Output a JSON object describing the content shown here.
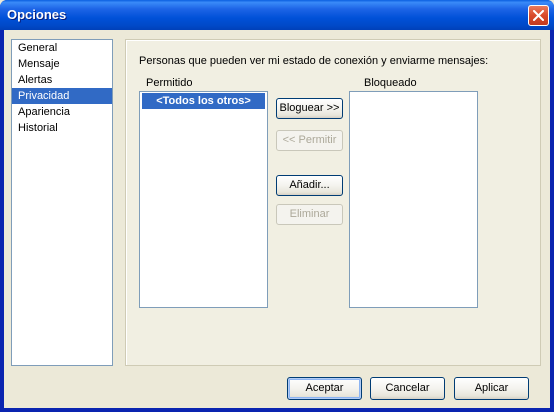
{
  "window": {
    "title": "Opciones",
    "close_icon": "close-icon"
  },
  "sidebar": {
    "items": [
      {
        "label": "General",
        "selected": false
      },
      {
        "label": "Mensaje",
        "selected": false
      },
      {
        "label": "Alertas",
        "selected": false
      },
      {
        "label": "Privacidad",
        "selected": true
      },
      {
        "label": "Apariencia",
        "selected": false
      },
      {
        "label": "Historial",
        "selected": false
      }
    ]
  },
  "privacy": {
    "description": "Personas que pueden ver mi estado de conexión y enviarme mensajes:",
    "allowed": {
      "label": "Permitido",
      "items": [
        {
          "label": "<Todos los otros>",
          "selected": true
        }
      ]
    },
    "blocked": {
      "label": "Bloqueado",
      "items": []
    },
    "buttons": {
      "block": "Bloguear >>",
      "allow": "<< Permitir",
      "add": "Añadir...",
      "remove": "Eliminar"
    }
  },
  "footer": {
    "accept": "Aceptar",
    "cancel": "Cancelar",
    "apply": "Aplicar"
  },
  "colors": {
    "selection": "#316AC5",
    "titlebar": "#0051D8",
    "dialog_bg": "#ECE9D8"
  }
}
